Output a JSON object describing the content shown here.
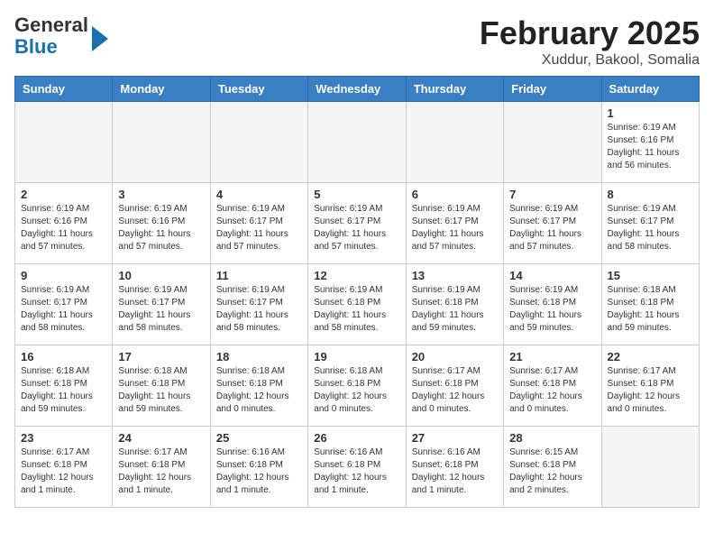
{
  "logo": {
    "general": "General",
    "blue": "Blue"
  },
  "title": "February 2025",
  "subtitle": "Xuddur, Bakool, Somalia",
  "weekdays": [
    "Sunday",
    "Monday",
    "Tuesday",
    "Wednesday",
    "Thursday",
    "Friday",
    "Saturday"
  ],
  "weeks": [
    [
      {
        "day": null,
        "info": null
      },
      {
        "day": null,
        "info": null
      },
      {
        "day": null,
        "info": null
      },
      {
        "day": null,
        "info": null
      },
      {
        "day": null,
        "info": null
      },
      {
        "day": null,
        "info": null
      },
      {
        "day": "1",
        "info": "Sunrise: 6:19 AM\nSunset: 6:16 PM\nDaylight: 11 hours and 56 minutes."
      }
    ],
    [
      {
        "day": "2",
        "info": "Sunrise: 6:19 AM\nSunset: 6:16 PM\nDaylight: 11 hours and 57 minutes."
      },
      {
        "day": "3",
        "info": "Sunrise: 6:19 AM\nSunset: 6:16 PM\nDaylight: 11 hours and 57 minutes."
      },
      {
        "day": "4",
        "info": "Sunrise: 6:19 AM\nSunset: 6:17 PM\nDaylight: 11 hours and 57 minutes."
      },
      {
        "day": "5",
        "info": "Sunrise: 6:19 AM\nSunset: 6:17 PM\nDaylight: 11 hours and 57 minutes."
      },
      {
        "day": "6",
        "info": "Sunrise: 6:19 AM\nSunset: 6:17 PM\nDaylight: 11 hours and 57 minutes."
      },
      {
        "day": "7",
        "info": "Sunrise: 6:19 AM\nSunset: 6:17 PM\nDaylight: 11 hours and 57 minutes."
      },
      {
        "day": "8",
        "info": "Sunrise: 6:19 AM\nSunset: 6:17 PM\nDaylight: 11 hours and 58 minutes."
      }
    ],
    [
      {
        "day": "9",
        "info": "Sunrise: 6:19 AM\nSunset: 6:17 PM\nDaylight: 11 hours and 58 minutes."
      },
      {
        "day": "10",
        "info": "Sunrise: 6:19 AM\nSunset: 6:17 PM\nDaylight: 11 hours and 58 minutes."
      },
      {
        "day": "11",
        "info": "Sunrise: 6:19 AM\nSunset: 6:17 PM\nDaylight: 11 hours and 58 minutes."
      },
      {
        "day": "12",
        "info": "Sunrise: 6:19 AM\nSunset: 6:18 PM\nDaylight: 11 hours and 58 minutes."
      },
      {
        "day": "13",
        "info": "Sunrise: 6:19 AM\nSunset: 6:18 PM\nDaylight: 11 hours and 59 minutes."
      },
      {
        "day": "14",
        "info": "Sunrise: 6:19 AM\nSunset: 6:18 PM\nDaylight: 11 hours and 59 minutes."
      },
      {
        "day": "15",
        "info": "Sunrise: 6:18 AM\nSunset: 6:18 PM\nDaylight: 11 hours and 59 minutes."
      }
    ],
    [
      {
        "day": "16",
        "info": "Sunrise: 6:18 AM\nSunset: 6:18 PM\nDaylight: 11 hours and 59 minutes."
      },
      {
        "day": "17",
        "info": "Sunrise: 6:18 AM\nSunset: 6:18 PM\nDaylight: 11 hours and 59 minutes."
      },
      {
        "day": "18",
        "info": "Sunrise: 6:18 AM\nSunset: 6:18 PM\nDaylight: 12 hours and 0 minutes."
      },
      {
        "day": "19",
        "info": "Sunrise: 6:18 AM\nSunset: 6:18 PM\nDaylight: 12 hours and 0 minutes."
      },
      {
        "day": "20",
        "info": "Sunrise: 6:17 AM\nSunset: 6:18 PM\nDaylight: 12 hours and 0 minutes."
      },
      {
        "day": "21",
        "info": "Sunrise: 6:17 AM\nSunset: 6:18 PM\nDaylight: 12 hours and 0 minutes."
      },
      {
        "day": "22",
        "info": "Sunrise: 6:17 AM\nSunset: 6:18 PM\nDaylight: 12 hours and 0 minutes."
      }
    ],
    [
      {
        "day": "23",
        "info": "Sunrise: 6:17 AM\nSunset: 6:18 PM\nDaylight: 12 hours and 1 minute."
      },
      {
        "day": "24",
        "info": "Sunrise: 6:17 AM\nSunset: 6:18 PM\nDaylight: 12 hours and 1 minute."
      },
      {
        "day": "25",
        "info": "Sunrise: 6:16 AM\nSunset: 6:18 PM\nDaylight: 12 hours and 1 minute."
      },
      {
        "day": "26",
        "info": "Sunrise: 6:16 AM\nSunset: 6:18 PM\nDaylight: 12 hours and 1 minute."
      },
      {
        "day": "27",
        "info": "Sunrise: 6:16 AM\nSunset: 6:18 PM\nDaylight: 12 hours and 1 minute."
      },
      {
        "day": "28",
        "info": "Sunrise: 6:15 AM\nSunset: 6:18 PM\nDaylight: 12 hours and 2 minutes."
      },
      {
        "day": null,
        "info": null
      }
    ]
  ]
}
